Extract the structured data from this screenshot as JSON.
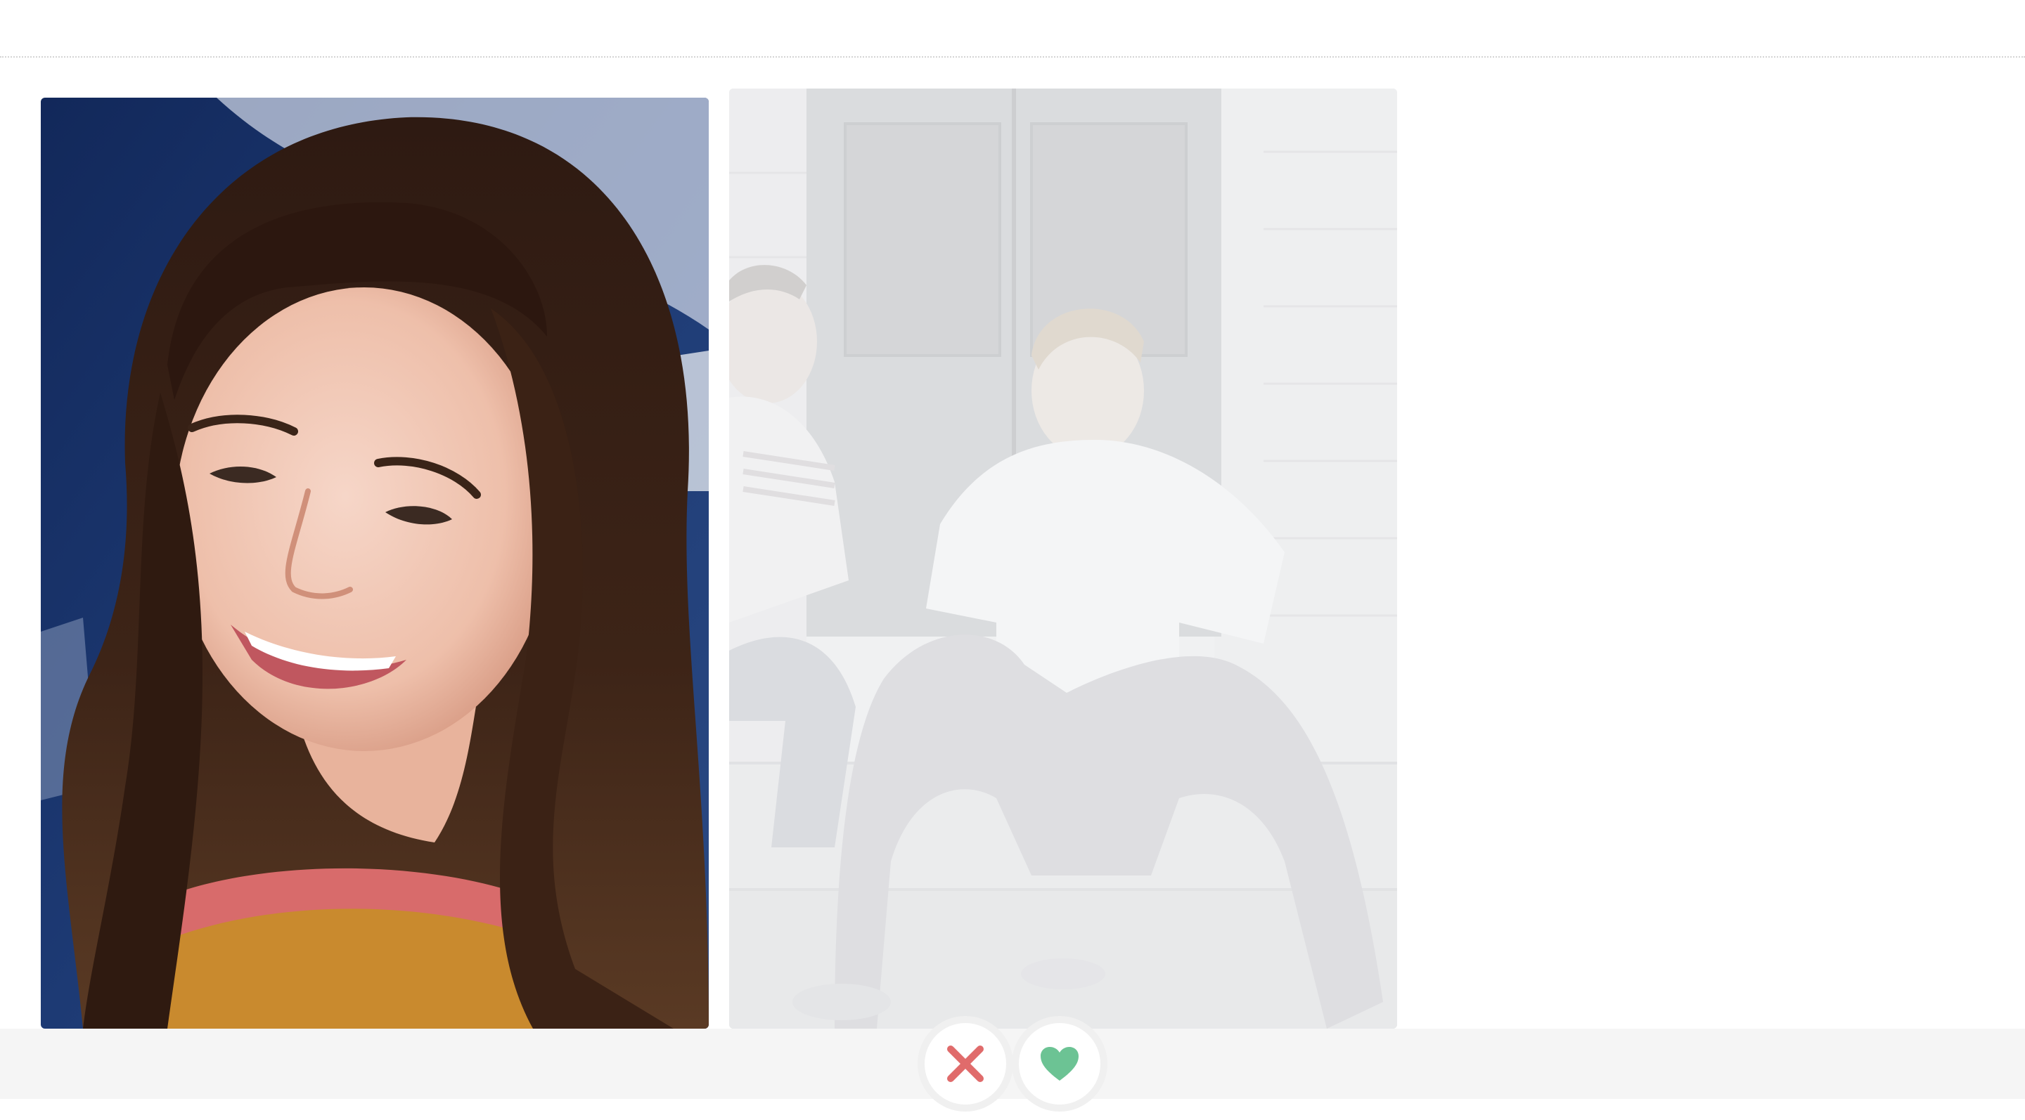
{
  "app": {
    "name": "swipe-deck"
  },
  "cards": [
    {
      "id": "current",
      "photo_alt": "",
      "opacity": 1.0
    },
    {
      "id": "next",
      "photo_alt": "",
      "opacity": 0.35
    }
  ],
  "actions": {
    "nope": {
      "icon": "close-x-icon",
      "color": "#e06b6b"
    },
    "like": {
      "icon": "heart-icon",
      "color": "#6cc394"
    }
  },
  "colors": {
    "nope": "#e06b6b",
    "like": "#6cc394",
    "action_bar_bg": "#f5f5f5",
    "button_ring": "#f0f0f0"
  }
}
